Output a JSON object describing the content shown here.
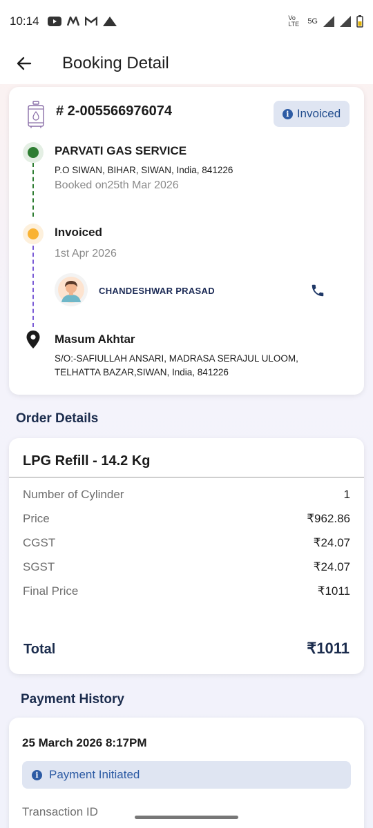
{
  "status_bar": {
    "time": "10:14",
    "network": "5G",
    "volte": "Vo LTE"
  },
  "header": {
    "title": "Booking Detail"
  },
  "booking": {
    "id": "# 2-005566976074",
    "status": "Invoiced",
    "distributor": {
      "name": "PARVATI GAS SERVICE",
      "address": "P.O SIWAN, BIHAR, SIWAN, India, 841226",
      "booked_on": "Booked on25th Mar 2026"
    },
    "invoice": {
      "label": "Invoiced",
      "date": "1st Apr 2026",
      "agent_name": "CHANDESHWAR PRASAD"
    },
    "customer": {
      "name": "Masum Akhtar",
      "address_line1": "S/O:-SAFIULLAH ANSARI, MADRASA SERAJUL ULOOM,",
      "address_line2": "TELHATTA BAZAR,SIWAN, India, 841226"
    },
    "colors": {
      "green": "#2e7d32",
      "orange": "#f9b233",
      "purple": "#7b5cd6"
    }
  },
  "order_details": {
    "section_title": "Order Details",
    "product": "LPG Refill - 14.2 Kg",
    "rows": [
      {
        "label": "Number of Cylinder",
        "value": "1"
      },
      {
        "label": "Price",
        "value": "₹962.86"
      },
      {
        "label": "CGST",
        "value": "₹24.07"
      },
      {
        "label": "SGST",
        "value": "₹24.07"
      },
      {
        "label": "Final Price",
        "value": "₹1011"
      }
    ],
    "total_label": "Total",
    "total_value": "₹1011"
  },
  "payment_history": {
    "section_title": "Payment History",
    "date": "25 March 2026 8:17PM",
    "status": "Payment Initiated",
    "transaction_label": "Transaction ID"
  }
}
